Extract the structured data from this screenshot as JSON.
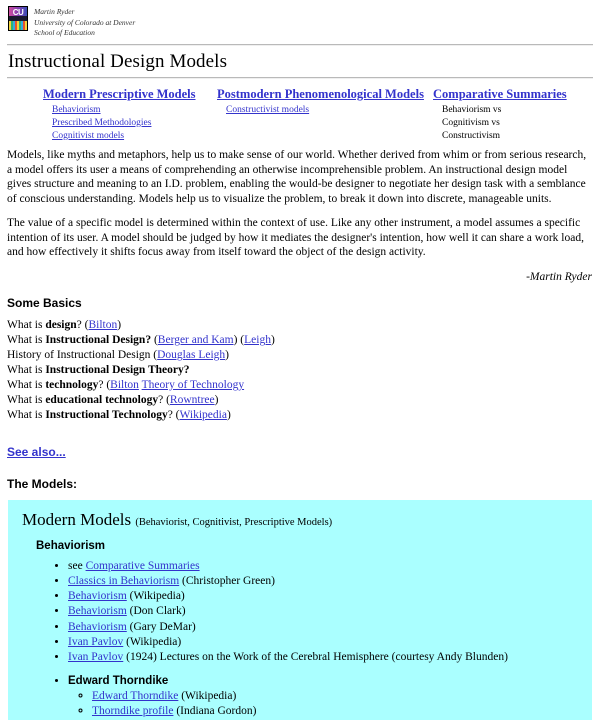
{
  "masthead": {
    "logo_text": "CU",
    "line1": "Martin Ryder",
    "line2": "University of Colorado at Denver",
    "line3": "School of Education"
  },
  "page_title": "Instructional Design Models",
  "nav": {
    "columns": [
      {
        "heading": "Modern Prescriptive Models",
        "items": [
          {
            "label": "Behaviorism",
            "link": true
          },
          {
            "label": "Prescribed Methodologies",
            "link": true
          },
          {
            "label": "Cognitivist models",
            "link": true
          }
        ]
      },
      {
        "heading": "Postmodern Phenomenological Models",
        "items": [
          {
            "label": "Constructivist models",
            "link": true
          }
        ]
      },
      {
        "heading": "Comparative Summaries",
        "items": [
          {
            "label": "Behaviorism vs",
            "link": false
          },
          {
            "label": "Cognitivism vs",
            "link": false
          },
          {
            "label": "Constructivism",
            "link": false
          }
        ]
      }
    ]
  },
  "paragraphs": {
    "p1": "Models, like myths and metaphors, help us to make sense of our world. Whether derived from whim or from serious research, a model offers its user a means of comprehending an otherwise incomprehensible problem. An instructional design model gives structure and meaning to an I.D. problem, enabling the would-be designer to negotiate her design task with a semblance of conscious understanding. Models help us to visualize the problem, to break it down into discrete, manageable units.",
    "p2": "The value of a specific model is determined within the context of use. Like any other instrument, a model assumes a specific intention of its user. A model should be judged by how it mediates the designer's intention, how well it can share a work load, and how effectively it shifts focus away from itself toward the object of the design activity.",
    "signature": "-Martin Ryder"
  },
  "some_basics": {
    "heading": "Some Basics",
    "lines": [
      {
        "prefix": "What is ",
        "bold": "design",
        "suffix": "? (",
        "links": [
          "Bilton"
        ],
        "tail": ")"
      },
      {
        "prefix": "What is ",
        "bold": "Instructional Design?",
        "suffix": " (",
        "links": [
          "Berger and Kam",
          "Leigh"
        ],
        "tail": ")"
      },
      {
        "prefix": "History of Instructional Design (",
        "bold": "",
        "suffix": "",
        "links": [
          "Douglas Leigh"
        ],
        "tail": ")"
      },
      {
        "prefix": "What is ",
        "bold": "Instructional Design Theory?",
        "suffix": "",
        "links": [],
        "tail": ""
      },
      {
        "prefix": "What is ",
        "bold": "technology",
        "suffix": "? (",
        "links": [
          "Bilton",
          "Theory of Technology"
        ],
        "tail": ""
      },
      {
        "prefix": "What is ",
        "bold": "educational technology",
        "suffix": "? (",
        "links": [
          "Rowntree"
        ],
        "tail": ")"
      },
      {
        "prefix": "What is ",
        "bold": "Instructional Technology",
        "suffix": "? (",
        "links": [
          "Wikipedia"
        ],
        "tail": ")"
      }
    ]
  },
  "see_also": "See also...",
  "the_models_label": "The Models:",
  "models_box": {
    "background_color": "#aaffff",
    "title": "Modern Models",
    "title_sub": "(Behaviorist, Cognitivist, Prescriptive Models)",
    "section": "Behaviorism",
    "items": [
      {
        "pre": "see ",
        "link": "Comparative Summaries",
        "post": ""
      },
      {
        "pre": "",
        "link": "Classics in Behaviorism",
        "post": " (Christopher Green)"
      },
      {
        "pre": "",
        "link": "Behaviorism",
        "post": " (Wikipedia)"
      },
      {
        "pre": "",
        "link": "Behaviorism",
        "post": " (Don Clark)"
      },
      {
        "pre": "",
        "link": "Behaviorism",
        "post": " (Gary DeMar)"
      },
      {
        "pre": "",
        "link": "Ivan Pavlov",
        "post": " (Wikipedia)"
      },
      {
        "pre": "",
        "link": "Ivan Pavlov",
        "post": " (1924) Lectures on the Work of the Cerebral Hemisphere (courtesy Andy Blunden)"
      }
    ],
    "thorndike": {
      "label": "Edward Thorndike",
      "subitems": [
        {
          "pre": "",
          "link": "Edward Thorndike",
          "post": " (Wikipedia)"
        },
        {
          "pre": "",
          "link": "Thorndike profile",
          "post": " (Indiana Gordon)"
        }
      ]
    }
  },
  "colors": {
    "link": "#3333cc",
    "box_cyan": "#aaffff",
    "rule": "#b9b9b9"
  }
}
